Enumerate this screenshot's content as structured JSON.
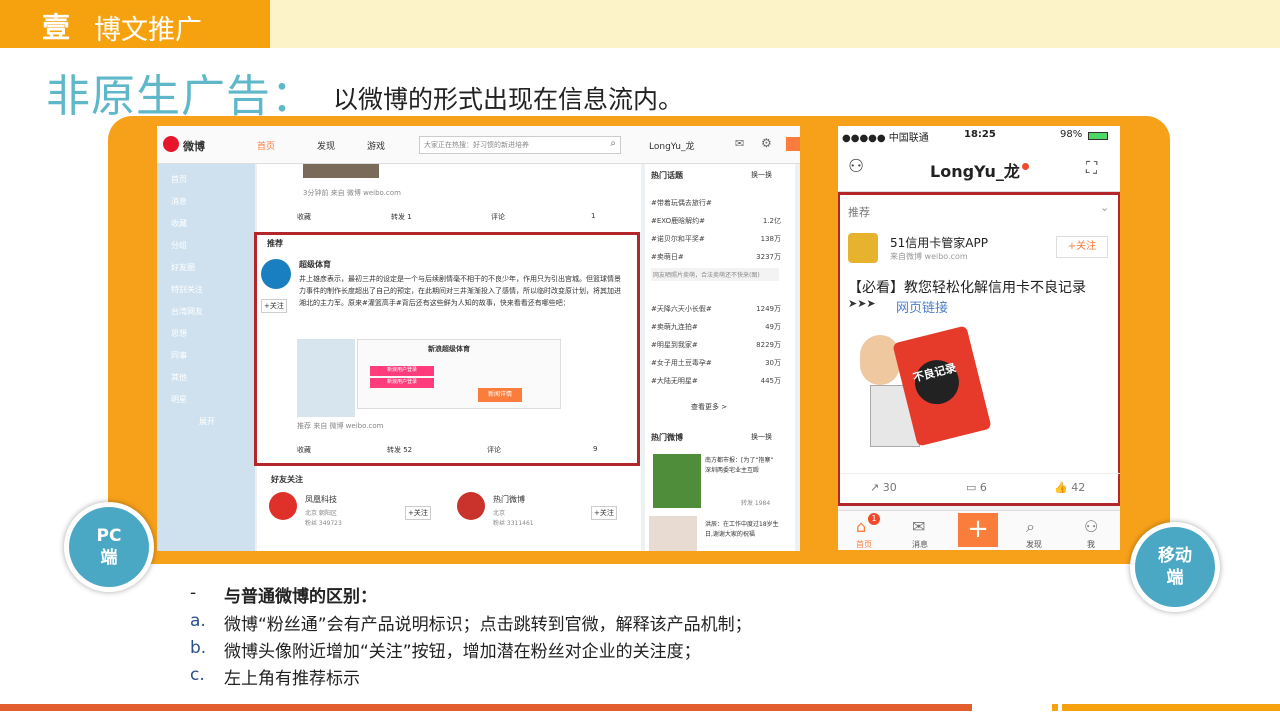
{
  "header": {
    "num": "壹",
    "title": "博文推广"
  },
  "title": "非原生广告：",
  "subtitle": "以微博的形式出现在信息流内。",
  "pc": {
    "logo": "微博",
    "nav": [
      "首页",
      "发现",
      "游戏"
    ],
    "search_placeholder": "大家正在热搜：好习惯的新进培养",
    "user": "LongYu_龙",
    "sidebar": [
      "首页",
      "消息",
      "收藏",
      "分组",
      "好友圈",
      "特别关注",
      "台湾网友",
      "思想",
      "同事",
      "其他",
      "明星",
      "展开"
    ],
    "post_top": {
      "meta": "3分钟前 来自 微博 weibo.com",
      "actions": [
        "收藏",
        "转发 1",
        "评论",
        "1"
      ]
    },
    "promo": {
      "tag": "推荐",
      "author": "超级体育",
      "follow": "+关注",
      "text": "井上雄彦表示，最初三井的设定是一个与后续剧情毫不相干的不良少年，作用只为引出宫城。但篮球情景力事件的制作长度超出了自己的预定，在此期间对三井渐渐投入了感情，所以临时改变原计划，将其加进湘北的主力军。原来#灌篮高手#背后还有这些鲜为人知的故事，快来看看还有哪些吧：",
      "link": "新浪超级体育",
      "card_title": "新浪超级体育",
      "card_btn1": "新浪用户登录",
      "card_btn2": "新浪用户登录",
      "card_detail": "新闻详情",
      "meta": "推荐 来自 微博 weibo.com",
      "actions": [
        "收藏",
        "转发 52",
        "评论",
        "9"
      ]
    },
    "friends": {
      "title": "好友关注",
      "items": [
        {
          "name": "凤凰科技",
          "loc": "北京 朝阳区",
          "fans": "粉丝 349723",
          "follow": "+关注"
        },
        {
          "name": "热门微博",
          "loc": "北京",
          "fans": "粉丝 3311461",
          "follow": "+关注"
        }
      ]
    },
    "hot_topics": {
      "title": "热门话题",
      "refresh": "换一换",
      "items": [
        {
          "name": "#带着玩偶去旅行#",
          "val": ""
        },
        {
          "name": "#EXO鹿晗解约#",
          "val": "1.2亿"
        },
        {
          "name": "#诺贝尔和平奖#",
          "val": "138万"
        },
        {
          "name": "#卖萌日#",
          "val": "3237万"
        },
        {
          "name": "#天降六天小长假#",
          "val": "1249万"
        },
        {
          "name": "#卖萌九连拍#",
          "val": "49万"
        },
        {
          "name": "#明星到我家#",
          "val": "8229万"
        },
        {
          "name": "#女子用土豆毒孕#",
          "val": "30万"
        },
        {
          "name": "#大陆无明星#",
          "val": "445万"
        }
      ],
      "note": "网友晒照片卖萌，合法卖萌还不快来(图)",
      "more": "查看更多 >"
    },
    "hot_weibo": {
      "title": "热门微博",
      "refresh": "换一换",
      "items": [
        {
          "text": "南方都市报：[为了“抱寨” 深圳两委宅业主互殴",
          "count": "转发 1984"
        },
        {
          "text": "洪辰：在工作中度过18岁生日,谢谢大家的祝福"
        }
      ]
    }
  },
  "mobile": {
    "carrier": "●●●●● 中国联通",
    "time": "18:25",
    "battery": "98%",
    "username": "LongYu_龙",
    "recommend": "推荐",
    "author": "51信用卡管家APP",
    "source": "来自微博 weibo.com",
    "follow": "+关注",
    "text": "【必看】教您轻松化解信用卡不良记录",
    "link": "网页链接",
    "card_text": "不良记录",
    "actions": [
      "30",
      "6",
      "42"
    ],
    "tabs": [
      "首页",
      "消息",
      "",
      "发现",
      "我"
    ],
    "badge": "1"
  },
  "labels": {
    "pc": [
      "PC",
      "端"
    ],
    "mobile": [
      "移动",
      "端"
    ]
  },
  "bullets": {
    "heading_dash": "-",
    "heading": "与普通微博的区别：",
    "items": [
      {
        "key": "a.",
        "text": "微博“粉丝通”会有产品说明标识；点击跳转到官微，解释该产品机制；"
      },
      {
        "key": "b.",
        "text": "微博头像附近增加“关注”按钮，增加潜在粉丝对企业的关注度；"
      },
      {
        "key": "c.",
        "text": "左上角有推荐标示"
      }
    ]
  },
  "colors": {
    "accent": "#f5a20e",
    "teal": "#5fb8c9",
    "red_box": "#b3262a",
    "weibo_orange": "#fa7d3c"
  }
}
